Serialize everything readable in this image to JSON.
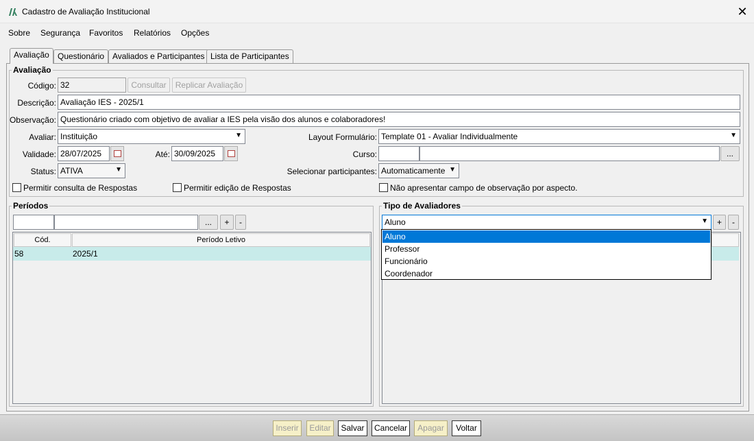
{
  "window": {
    "title": "Cadastro de Avaliação Institucional",
    "close_glyph": "✕"
  },
  "menu": [
    "Sobre",
    "Segurança",
    "Favoritos",
    "Relatórios",
    "Opções"
  ],
  "tabs": [
    "Avaliação",
    "Questionário",
    "Avaliados e Participantes",
    "Lista de Participantes"
  ],
  "avaliacao": {
    "legend": "Avaliação",
    "codigo_label": "Código:",
    "codigo_value": "32",
    "consultar": "Consultar",
    "replicar": "Replicar Avaliação",
    "descricao_label": "Descrição:",
    "descricao_value": "Avaliação IES - 2025/1",
    "observacao_label": "Observação:",
    "observacao_value": "Questionário criado com objetivo de avaliar a IES pela visão dos alunos e colaboradores!",
    "avaliar_label": "Avaliar:",
    "avaliar_value": "Instituição",
    "layout_label": "Layout Formulário:",
    "layout_value": "Template 01 - Avaliar Individualmente",
    "validade_label": "Validade:",
    "validade_value": "28/07/2025",
    "ate_label": "Até:",
    "ate_value": "30/09/2025",
    "curso_label": "Curso:",
    "curso_code": "",
    "curso_name": "",
    "curso_btn": "...",
    "status_label": "Status:",
    "status_value": "ATIVA",
    "selecionar_label": "Selecionar participantes:",
    "selecionar_value": "Automaticamente",
    "chk_consulta": "Permitir consulta de Respostas",
    "chk_edicao": "Permitir edição de Respostas",
    "chk_observacao": "Não apresentar campo de observação por aspecto."
  },
  "periodos": {
    "legend": "Períodos",
    "btn_browse": "...",
    "btn_add": "+",
    "btn_remove": "-",
    "columns": [
      "Cód.",
      "Período Letivo"
    ],
    "rows": [
      {
        "cod": "58",
        "periodo": "2025/1"
      }
    ]
  },
  "tipo_avaliadores": {
    "legend": "Tipo de Avaliadores",
    "selected": "Aluno",
    "btn_add": "+",
    "btn_remove": "-",
    "options": [
      "Aluno",
      "Professor",
      "Funcionário",
      "Coordenador"
    ]
  },
  "footer": {
    "inserir": "Inserir",
    "editar": "Editar",
    "salvar": "Salvar",
    "cancelar": "Cancelar",
    "apagar": "Apagar",
    "voltar": "Voltar"
  },
  "colors": {
    "selection": "#0078d7",
    "row_highlight": "#c8ebea",
    "disabled_footer": "#f6f0c8",
    "logo": "#2e7d5b"
  }
}
